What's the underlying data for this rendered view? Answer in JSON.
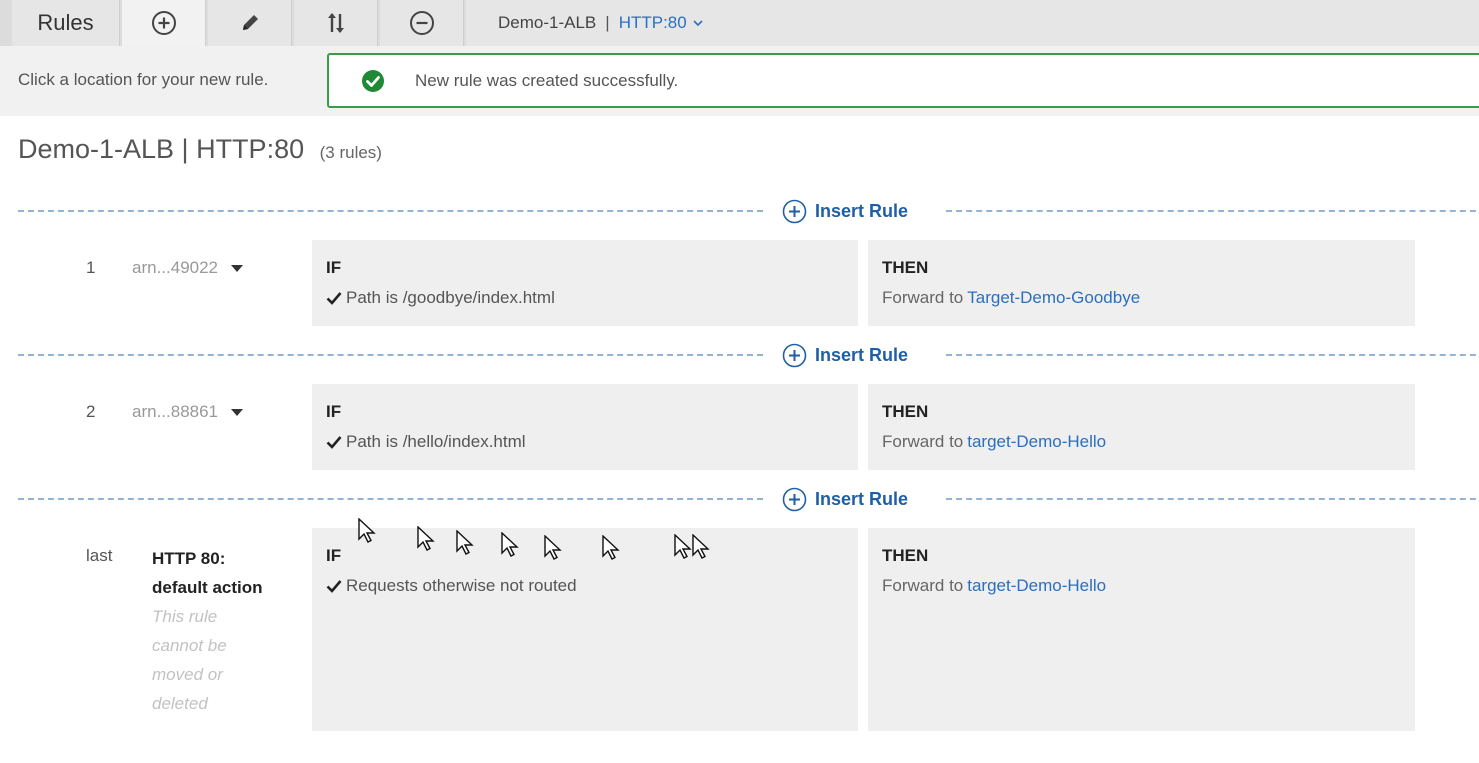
{
  "tabs": {
    "rules_label": "Rules",
    "listener_name": "Demo-1-ALB",
    "listener_separator": "|",
    "listener_port": "HTTP:80"
  },
  "message": {
    "hint": "Click a location for your new rule.",
    "success": "New rule was created successfully."
  },
  "heading": {
    "title": "Demo-1-ALB | HTTP:80",
    "count": "(3 rules)"
  },
  "insert_rule_label": "Insert Rule",
  "rules": [
    {
      "num": "1",
      "arn": "arn...49022",
      "if_label": "IF",
      "condition": "Path is /goodbye/index.html",
      "then_label": "THEN",
      "action": "Forward to",
      "target": "Target-Demo-Goodbye"
    },
    {
      "num": "2",
      "arn": "arn...88861",
      "if_label": "IF",
      "condition": "Path is /hello/index.html",
      "then_label": "THEN",
      "action": "Forward to",
      "target": "target-Demo-Hello"
    }
  ],
  "default_rule": {
    "num": "last",
    "title_line1": "HTTP 80:",
    "title_line2": "default action",
    "note_lines": [
      "This rule",
      "cannot be",
      "moved or",
      "deleted"
    ],
    "if_label": "IF",
    "condition": "Requests otherwise not routed",
    "then_label": "THEN",
    "action": "Forward to",
    "target": "target-Demo-Hello"
  },
  "colors": {
    "accent_link": "#2a6fc0",
    "insert_blue": "#1e5fa8",
    "success_green": "#3d9a4a",
    "dash_blue": "#8fb4d8"
  },
  "icons": {
    "add": "plus-circle-icon",
    "edit": "pencil-icon",
    "reorder": "reorder-arrows-icon",
    "remove": "minus-circle-icon",
    "success": "check-circle-icon"
  }
}
